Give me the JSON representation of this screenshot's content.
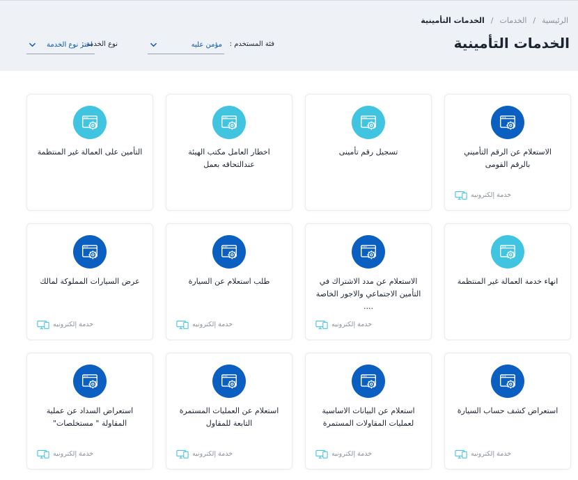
{
  "breadcrumb": [
    "الرئيسية",
    "الخدمات",
    "الخدمات التأمينية"
  ],
  "breadcrumb_separator": "/",
  "page_title": "الخدمات التأمينية",
  "filters": {
    "user_category": {
      "label": "فئة المستخدم :",
      "value": "مؤمن عليه"
    },
    "service_type": {
      "label": "نوع الخدمة :",
      "value": "اختر نوع الخدمة"
    }
  },
  "colors": {
    "dark_icon": "#0a5fc1",
    "light_icon": "#41c4e0",
    "accent": "#0a57b5"
  },
  "cards": [
    {
      "title": "الاستعلام عن الرقم التأميني بالرقم القومى",
      "icon": "browser-gear-icon",
      "icon_style": "dark",
      "footer": "خدمة إلكترونيه"
    },
    {
      "title": "تسجيل رقم تأمينى",
      "icon": "browser-gear-icon",
      "icon_style": "light",
      "footer": ""
    },
    {
      "title": "اخطار العامل مكتب الهيئة عندالتحاقه بعمل",
      "icon": "browser-gear-icon",
      "icon_style": "light",
      "footer": ""
    },
    {
      "title": "التأمين على العمالة غير المنتظمة",
      "icon": "browser-gear-icon",
      "icon_style": "light",
      "footer": ""
    },
    {
      "title": "انهاء خدمة العمالة غير المنتظمة",
      "icon": "browser-gear-icon",
      "icon_style": "light",
      "footer": ""
    },
    {
      "title": "الاستعلام عن مدد الاشتراك في التأمين الاجتماعي والاجور الخاصة ....",
      "icon": "browser-gear-icon",
      "icon_style": "dark",
      "footer": "خدمة إلكترونيه"
    },
    {
      "title": "طلب استعلام عن السيارة",
      "icon": "browser-gear-icon",
      "icon_style": "dark",
      "footer": "خدمة إلكترونيه"
    },
    {
      "title": "عرض السيارات المملوكة لمالك",
      "icon": "browser-gear-icon",
      "icon_style": "dark",
      "footer": "خدمة إلكترونيه"
    },
    {
      "title": "استعراض كشف حساب السيارة",
      "icon": "browser-gear-icon",
      "icon_style": "dark",
      "footer": "خدمة إلكترونيه"
    },
    {
      "title": "استعلام عن البيانات الاساسية لعمليات المقاولات المستمرة",
      "icon": "browser-gear-icon",
      "icon_style": "dark",
      "footer": "خدمة إلكترونيه"
    },
    {
      "title": "استعلام عن العمليات المستمرة التابعة للمقاول",
      "icon": "browser-gear-icon",
      "icon_style": "dark",
      "footer": "خدمة إلكترونيه"
    },
    {
      "title": "استعراض السداد عن عملية المقاولة \" مستخلصات\"",
      "icon": "browser-gear-icon",
      "icon_style": "dark",
      "footer": "خدمة إلكترونيه"
    }
  ]
}
